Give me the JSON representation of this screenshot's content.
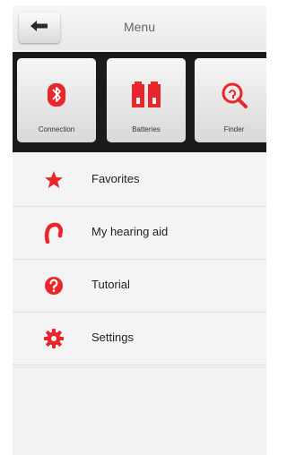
{
  "header": {
    "title": "Menu",
    "back_icon": "arrow-left-icon"
  },
  "quickbar": {
    "items": [
      {
        "label": "Connection",
        "icon": "bluetooth-icon"
      },
      {
        "label": "Batteries",
        "icon": "batteries-icon"
      },
      {
        "label": "Finder",
        "icon": "finder-icon"
      }
    ]
  },
  "menu": {
    "items": [
      {
        "label": "Favorites",
        "icon": "star-icon"
      },
      {
        "label": "My hearing aid",
        "icon": "hearing-aid-icon"
      },
      {
        "label": "Tutorial",
        "icon": "help-icon"
      },
      {
        "label": "Settings",
        "icon": "gear-icon"
      }
    ]
  },
  "colors": {
    "accent": "#e8262b",
    "dark_bar": "#1a1a1a",
    "background": "#f2f2f2"
  }
}
